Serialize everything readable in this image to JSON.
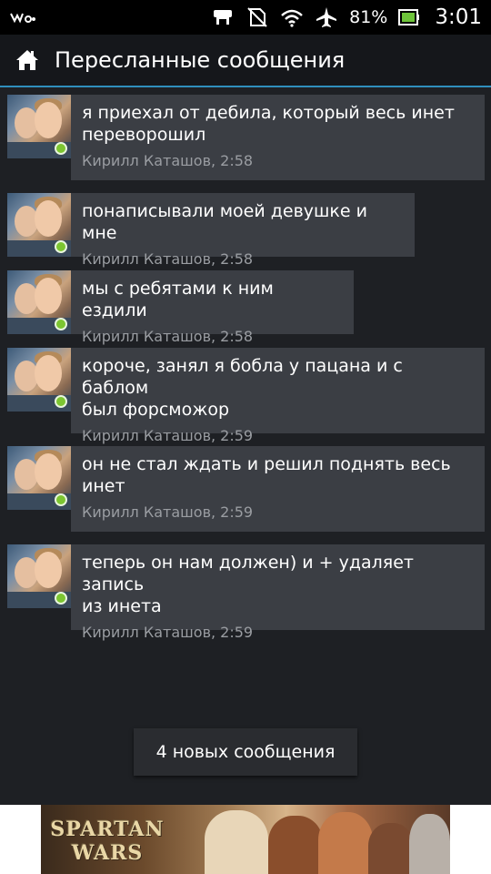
{
  "status_bar": {
    "battery_percent": "81%",
    "time": "3:01",
    "icons": [
      "walkman-icon",
      "usb-debug-icon",
      "no-sim-icon",
      "wifi-icon",
      "airplane-mode-icon",
      "battery-icon"
    ]
  },
  "action_bar": {
    "title": "Пересланные сообщения",
    "icon": "home-icon"
  },
  "messages": [
    {
      "text": "я приехал от дебила, который весь инет\nпереворошил",
      "meta": "Кирилл Каташов, 2:58"
    },
    {
      "text": "понаписывали моей девушке и мне",
      "meta": "Кирилл Каташов, 2:58"
    },
    {
      "text": "мы с ребятами к ним ездили",
      "meta": "Кирилл Каташов, 2:58"
    },
    {
      "text": "короче, занял я бобла у пацана и с баблом\nбыл форсможор",
      "meta": "Кирилл Каташов, 2:59"
    },
    {
      "text": "он не стал ждать и решил поднять весь\nинет",
      "meta": "Кирилл Каташов, 2:59"
    },
    {
      "text": "теперь он нам должен) и + удаляет запись\nиз инета",
      "meta": "Кирилл Каташов, 2:59"
    }
  ],
  "new_messages_label": "4 новых сообщения",
  "banner": {
    "logo_line1": "SPARTAN",
    "logo_line2": "WARS"
  },
  "colors": {
    "accent": "#2f8fbd",
    "online": "#7cc531",
    "bubble": "#3b3e44",
    "background": "#1e2024"
  }
}
